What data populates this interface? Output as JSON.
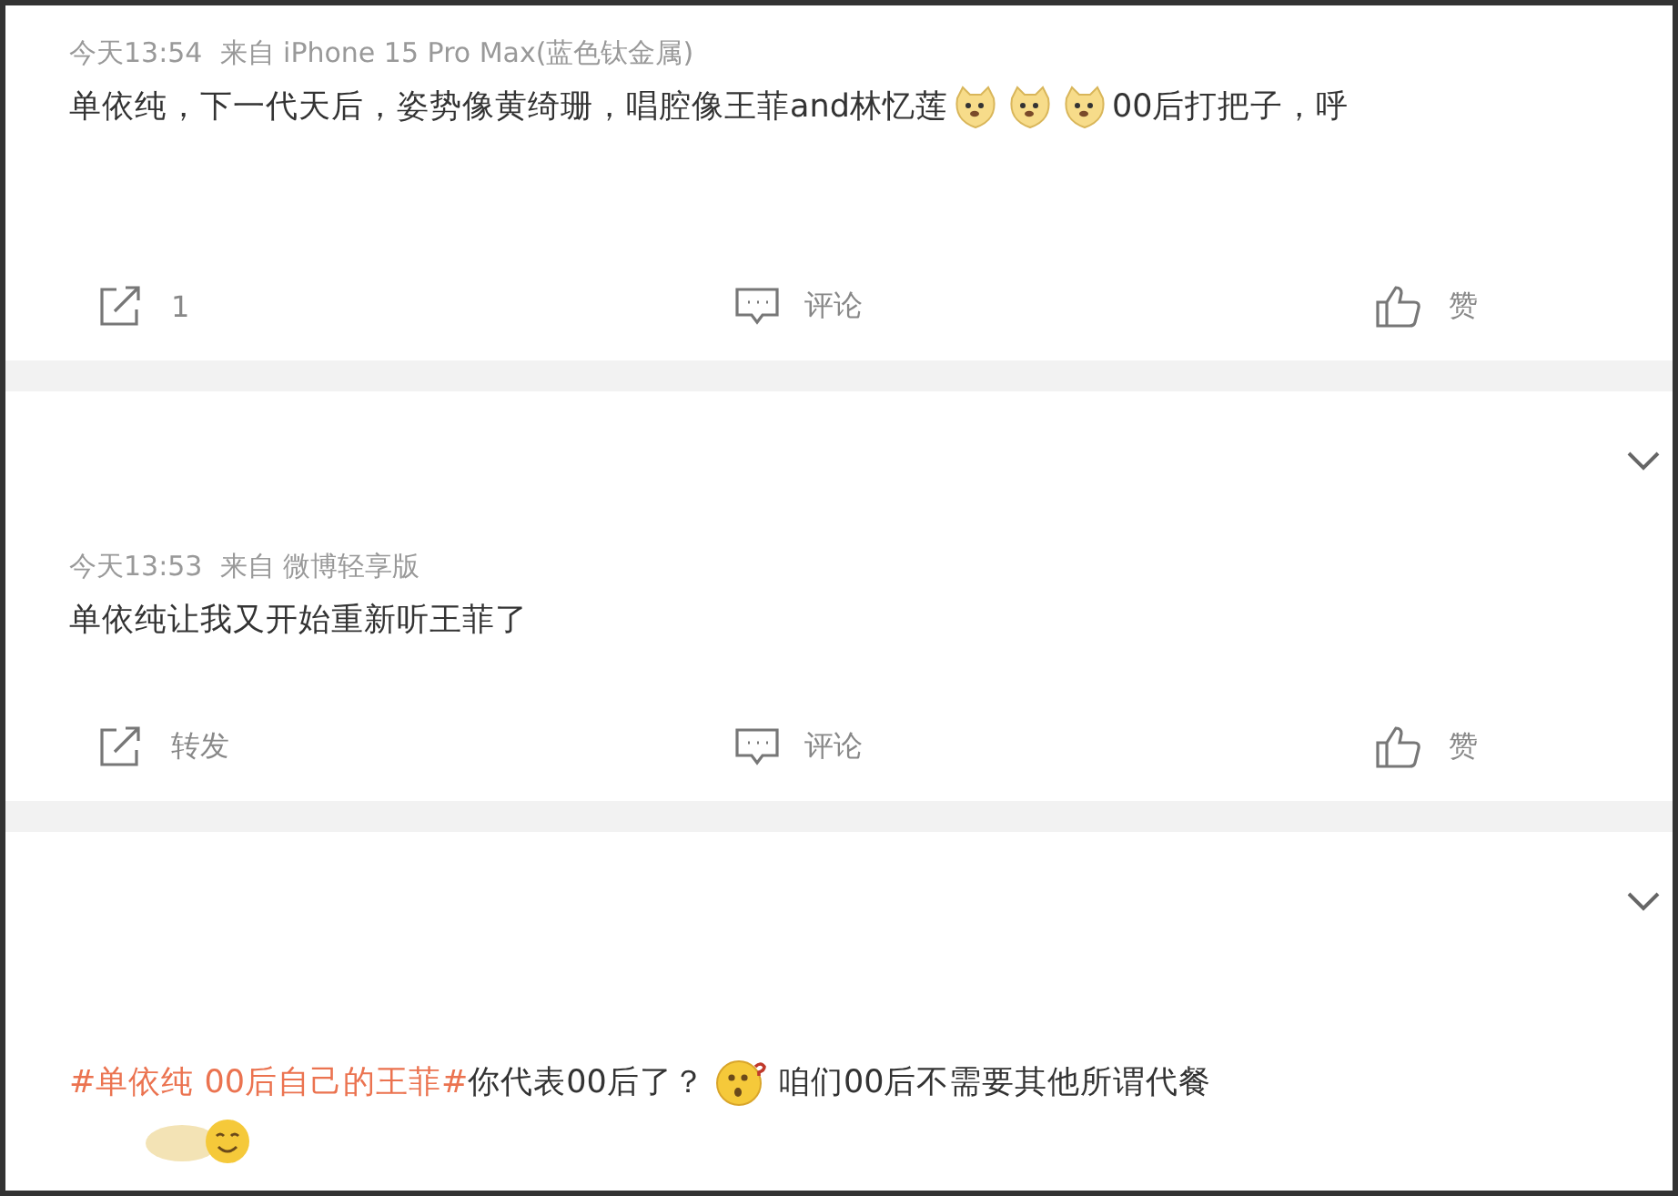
{
  "posts": [
    {
      "collapse_chevron": false,
      "meta": "今天13:54  来自 iPhone 15 Pro Max(蓝色钛金属)",
      "body": [
        {
          "kind": "text",
          "text": "单依纯，下一代天后，姿势像黄绮珊，唱腔像王菲and林忆莲"
        },
        {
          "kind": "emoji"
        },
        {
          "kind": "emoji"
        },
        {
          "kind": "emoji"
        },
        {
          "kind": "text",
          "text": "00后打把子，呼"
        }
      ],
      "extra_emoji": false,
      "actions": [
        {
          "kind": "repost",
          "label": "1"
        },
        {
          "kind": "comment",
          "label": "评论"
        },
        {
          "kind": "like",
          "label": "赞"
        }
      ]
    },
    {
      "collapse_chevron": true,
      "meta": "今天13:53  来自 微博轻享版",
      "body": [
        {
          "kind": "text",
          "text": "单依纯让我又开始重新听王菲了"
        }
      ],
      "extra_emoji": false,
      "actions": [
        {
          "kind": "repost",
          "label": "转发"
        },
        {
          "kind": "comment",
          "label": "评论"
        },
        {
          "kind": "like",
          "label": "赞"
        }
      ]
    },
    {
      "collapse_chevron": true,
      "body": [
        {
          "kind": "hashtag",
          "text": "#单依纯 00后自己的王菲#"
        },
        {
          "kind": "text",
          "text": "你代表00后了？"
        },
        {
          "kind": "puzzled"
        },
        {
          "kind": "text",
          "text": "咱们00后不需要其他所谓代餐"
        }
      ],
      "extra_emoji": true
    }
  ]
}
